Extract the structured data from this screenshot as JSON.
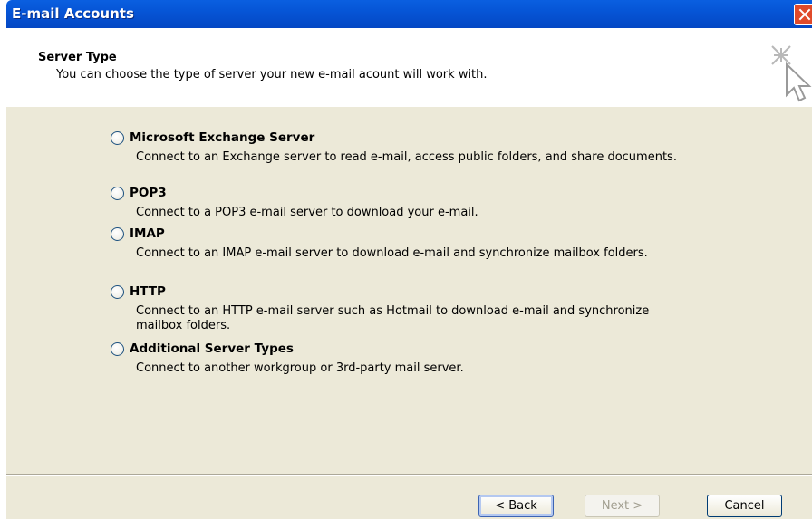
{
  "window": {
    "title": "E-mail Accounts"
  },
  "header": {
    "title": "Server Type",
    "subtitle": "You can choose the type of server your new e-mail acount will work with."
  },
  "options": [
    {
      "label": "Microsoft Exchange Server",
      "description": "Connect to an Exchange server to read e-mail, access public folders, and share documents.",
      "selected": false
    },
    {
      "label": "POP3",
      "description": "Connect to a POP3 e-mail server to download your e-mail.",
      "selected": false
    },
    {
      "label": "IMAP",
      "description": "Connect to an IMAP e-mail server to download e-mail and synchronize mailbox folders.",
      "selected": false
    },
    {
      "label": "HTTP",
      "description": "Connect to an HTTP e-mail server such as Hotmail to download e-mail and synchronize mailbox folders.",
      "selected": false
    },
    {
      "label": "Additional Server Types",
      "description": "Connect to another workgroup or 3rd-party mail server.",
      "selected": false
    }
  ],
  "buttons": {
    "back": "< Back",
    "next": "Next >",
    "cancel": "Cancel"
  },
  "colors": {
    "titlebar": "#0655d6",
    "dialog_background": "#ece9d8"
  }
}
